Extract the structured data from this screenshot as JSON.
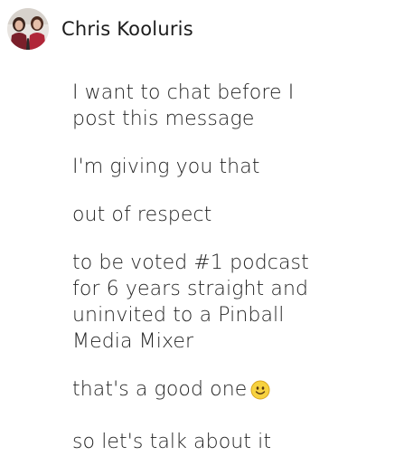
{
  "post": {
    "author": {
      "name": "Chris Kooluris",
      "avatar_icon": "profile-photo"
    },
    "message": {
      "paragraphs": [
        {
          "lines": [
            "I want to chat before I",
            "post this message"
          ]
        },
        {
          "lines": [
            "I'm giving you that"
          ]
        },
        {
          "lines": [
            "out of respect"
          ]
        },
        {
          "lines": [
            "to be voted #1 podcast",
            "for 6 years straight and",
            "uninvited to a Pinball",
            "Media Mixer"
          ]
        },
        {
          "lines": [
            "that's a good one"
          ],
          "emoji": "smiley-face-icon"
        },
        {
          "lines": [
            "so let's talk about it"
          ]
        }
      ]
    }
  }
}
